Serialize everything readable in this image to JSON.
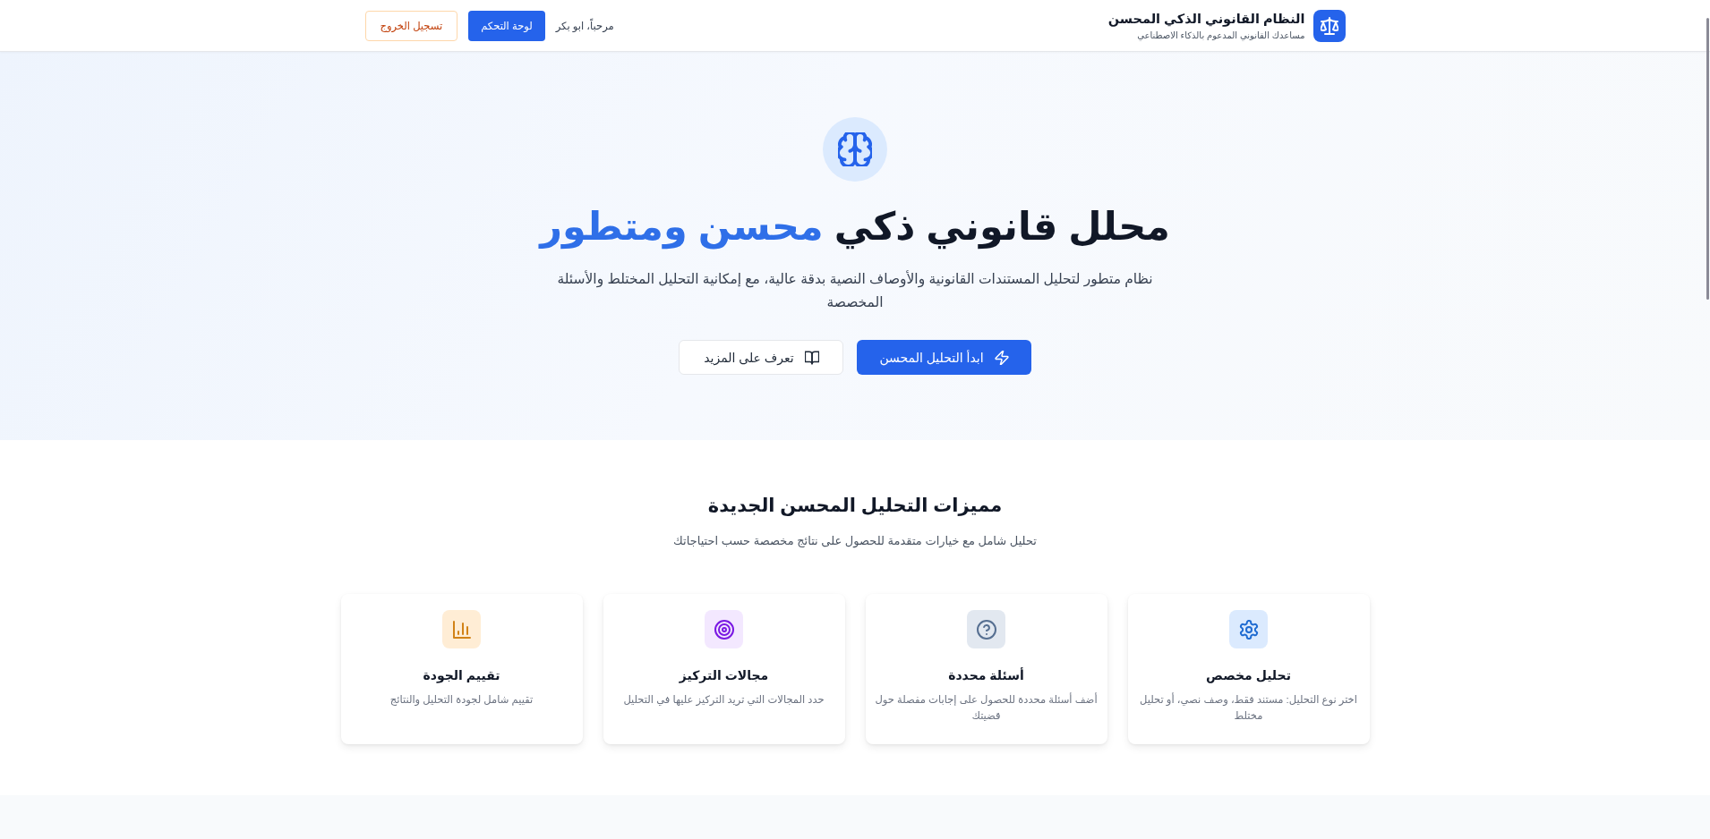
{
  "header": {
    "logo": {
      "title": "النظام القانوني الذكي المحسن",
      "subtitle": "مساعدك القانوني المدعوم بالذكاء الاصطناعي"
    },
    "greeting": "مرحباً، ابو بكر",
    "buttons": [
      {
        "label": "لوحة التحكم",
        "kind": "primary"
      },
      {
        "label": "تسجيل الخروج",
        "kind": "warning-outline"
      }
    ]
  },
  "hero": {
    "title": "محلل قانوني ذكي",
    "title_highlight": "محسن ومتطور",
    "description": "نظام متطور لتحليل المستندات القانونية والأوصاف النصية بدقة عالية، مع إمكانية التحليل المختلط والأسئلة المخصصة",
    "buttons": [
      {
        "label": "ابدأ التحليل المحسن",
        "kind": "primary"
      },
      {
        "label": "تعرف على المزيد",
        "kind": "outline"
      }
    ]
  },
  "features": {
    "title": "مميزات التحليل المحسن الجديدة",
    "subtitle": "تحليل شامل مع خيارات متقدمة للحصول على نتائج مخصصة حسب احتياجاتك",
    "cards": [
      {
        "title": "تحليل مخصص",
        "description": "اختر نوع التحليل: مستند فقط، وصف نصي، أو تحليل مختلط",
        "color": "#dbeafe"
      },
      {
        "title": "أسئلة محددة",
        "description": "أضف أسئلة محددة للحصول على إجابات مفصلة حول قضيتك",
        "color": "#e2e8f0"
      },
      {
        "title": "مجالات التركيز",
        "description": "حدد المجالات التي تريد التركيز عليها في التحليل",
        "color": "#f3e8ff"
      },
      {
        "title": "تقييم الجودة",
        "description": "تقييم شامل لجودة التحليل والنتائج",
        "color": "#ffedd5"
      }
    ]
  }
}
